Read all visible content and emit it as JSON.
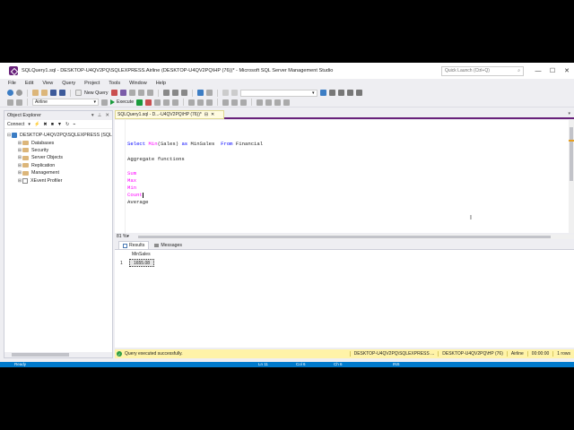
{
  "window": {
    "title": "SQLQuery1.sql - DESKTOP-U4QV2PQ\\SQLEXPRESS.Airline (DESKTOP-U4QV2PQ\\HP (76))* - Microsoft SQL Server Management Studio",
    "quick_launch_placeholder": "Quick Launch (Ctrl+Q)",
    "minimize": "—",
    "maximize": "☐",
    "close": "✕"
  },
  "menu": [
    "File",
    "Edit",
    "View",
    "Query",
    "Project",
    "Tools",
    "Window",
    "Help"
  ],
  "toolbar": {
    "new_query": "New Query",
    "database_combo": "Airline",
    "execute": "Execute"
  },
  "object_explorer": {
    "title": "Object Explorer",
    "connect": "Connect",
    "server": "DESKTOP-U4QV2PQ\\SQLEXPRESS (SQL",
    "nodes": [
      "Databases",
      "Security",
      "Server Objects",
      "Replication",
      "Management",
      "XEvent Profiler"
    ]
  },
  "doc_tab": {
    "label": "SQLQuery1.sql - D...-U4QV2PQ\\HP (76))*",
    "pin": "⊟",
    "close": "✕"
  },
  "editor": {
    "line1": {
      "kw1": "Select",
      "fn1": "Min",
      "p1": "(Sales) ",
      "kw2": "as",
      "p2": " MinSales  ",
      "kw3": "From",
      "p3": " Financial"
    },
    "line2": {
      "a": "Aggregate",
      "b": "functions"
    },
    "sum": "Sum",
    "max": "Max",
    "min": "Min",
    "count": "Count",
    "average": "Average"
  },
  "zoom": "81 %",
  "results_tabs": {
    "results": "Results",
    "messages": "Messages"
  },
  "results_grid": {
    "column": "MinSales",
    "row_number": "1",
    "value": "1655.08"
  },
  "query_status": {
    "message": "Query executed successfully.",
    "server": "DESKTOP-U4QV2PQ\\SQLEXPRESS ...",
    "user": "DESKTOP-U4QV2PQ\\HP (76)",
    "database": "Airline",
    "time": "00:00:00",
    "rows": "1 rows"
  },
  "statusbar": {
    "ready": "Ready",
    "line": "Ln 11",
    "col": "Col 6",
    "ch": "Ch 6",
    "ins": "INS"
  },
  "colors": {
    "accent": "#68217a",
    "status": "#007acc",
    "success_bar": "#fff3a8"
  }
}
